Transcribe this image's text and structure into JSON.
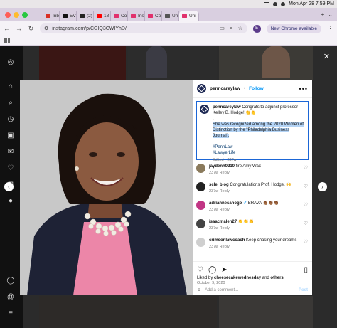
{
  "menubar": {
    "datetime": "Mon Apr 28  7:59 PM"
  },
  "tabs": [
    {
      "label": "Inb",
      "color": "#d93025"
    },
    {
      "label": "EVI",
      "color": "#111111"
    },
    {
      "label": "(2)",
      "color": "#222222"
    },
    {
      "label": "18 i",
      "color": "#ff0000"
    },
    {
      "label": "Co",
      "color": "#e1306c"
    },
    {
      "label": "Ins",
      "color": "#e1306c"
    },
    {
      "label": "Co",
      "color": "#e1306c"
    },
    {
      "label": "Uni",
      "color": "#555555"
    },
    {
      "label": "Uni",
      "color": "#e1306c"
    }
  ],
  "address": {
    "url": "instagram.com/p/CGIQ3CWIYhD/",
    "chrome_button": "New Chrome available",
    "profile_letter": "E"
  },
  "post": {
    "username": "penncareylaw",
    "follow": "Follow",
    "caption_user": "penncareylaw",
    "caption_line1": "Congrats to adjunct professor Kelley B. Hodge! 👏👏",
    "caption_dot1": ".",
    "caption_highlight": "She was recognized among the 2020 Women of Distinction by the \"Philadelphia Business Journal\".",
    "caption_dot2": ".",
    "tag1": "#PennLaw",
    "tag2": "#LawyerLife",
    "edited": "Edited · 237w",
    "likes_prefix": "Liked by ",
    "likes_user": "cheesecakewednesday",
    "likes_suffix": " and ",
    "likes_others": "others",
    "date": "October 9, 2020",
    "add_comment": "Add a comment...",
    "post_btn": "Post"
  },
  "comments": [
    {
      "user": "jaydenh0210",
      "text": "fire Amy Wax",
      "meta": "237w   Reply",
      "color": "#8a7a5c"
    },
    {
      "user": "scle_blog",
      "text": "Congratulations Prof. Hodge. 🙌",
      "meta": "237w   Reply",
      "color": "#222222"
    },
    {
      "user": "adriannesanogo",
      "text": "BRAVA 👏🏾👏🏾👏🏾",
      "meta": "237w   Reply",
      "color": "#c13584",
      "verified": "✔"
    },
    {
      "user": "isaacmaleh27",
      "text": "👏👏👏",
      "meta": "237w   Reply",
      "color": "#444444"
    },
    {
      "user": "crimsonlawcoach",
      "text": "Keep chasing your dreams",
      "meta": "237w   Reply",
      "color": "#cfcfcf"
    }
  ],
  "colors": {
    "accent": "#0095f6",
    "highlight": "#b3d3f5",
    "selection_border": "#1b66d6"
  }
}
